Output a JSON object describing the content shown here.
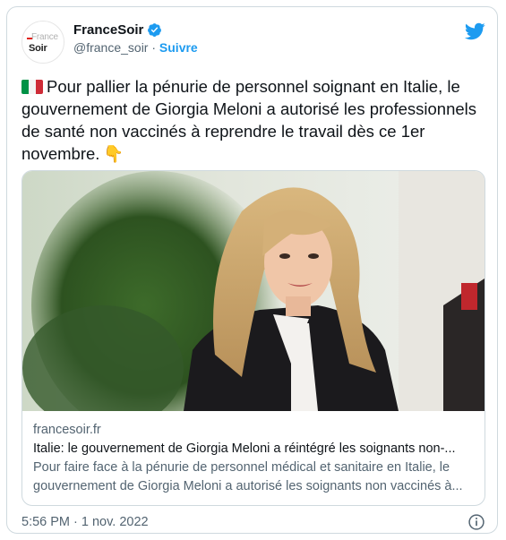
{
  "account": {
    "name": "FranceSoir",
    "handle": "@france_soir",
    "separator": "·",
    "follow_label": "Suivre",
    "avatar_line1": "France",
    "avatar_line2": "Soir"
  },
  "tweet": {
    "text": "Pour pallier la pénurie de personnel soignant en Italie, le gouvernement de Giorgia Meloni a autorisé les professionnels de santé non vaccinés à reprendre le travail dès ce 1er novembre.",
    "emoji_hand": "👇"
  },
  "card": {
    "domain": "francesoir.fr",
    "title": "Italie: le gouvernement de Giorgia Meloni a réintégré les soignants non-...",
    "description": "Pour faire face à la pénurie de personnel médical et sanitaire en Italie, le gouvernement de Giorgia Meloni a autorisé les soignants non vaccinés à..."
  },
  "footer": {
    "timestamp": "5:56 PM · 1 nov. 2022"
  },
  "colors": {
    "accent": "#1d9bf0",
    "flag_green": "#009246",
    "flag_white": "#ffffff",
    "flag_red": "#ce2b37"
  },
  "icons": [
    "verified-badge-icon",
    "twitter-bird-icon",
    "italy-flag-icon",
    "pointing-down-hand-icon",
    "info-icon"
  ]
}
